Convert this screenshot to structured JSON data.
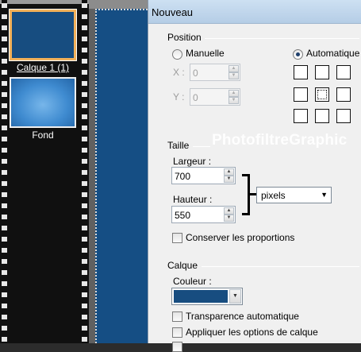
{
  "layers": {
    "items": [
      {
        "name": "Calque 1 (1)",
        "selected": true,
        "thumb_color": "#174d80"
      },
      {
        "name": "Fond",
        "selected": false,
        "thumb_color": "#4d97da"
      }
    ]
  },
  "dialog": {
    "title": "Nouveau",
    "position": {
      "title": "Position",
      "manual_label": "Manuelle",
      "automatic_label": "Automatique",
      "selected": "automatic",
      "x_label": "X :",
      "x_value": "0",
      "y_label": "Y :",
      "y_value": "0",
      "anchor_selected": "center"
    },
    "size": {
      "title": "Taille",
      "width_label": "Largeur :",
      "width_value": "700",
      "height_label": "Hauteur :",
      "height_value": "550",
      "unit": "pixels",
      "keep_proportions_label": "Conserver les proportions",
      "keep_proportions_checked": false
    },
    "layer": {
      "title": "Calque",
      "color_label": "Couleur :",
      "color_value": "#174d80",
      "auto_transparency_label": "Transparence automatique",
      "auto_transparency_checked": false,
      "apply_options_label": "Appliquer les options de calque",
      "apply_options_checked": false
    }
  },
  "watermark": "PhotofiltreGraphic",
  "colors": {
    "accent_selection": "#f2b15a",
    "canvas_fill": "#154e84",
    "dialog_bg": "#f0f0f0"
  }
}
